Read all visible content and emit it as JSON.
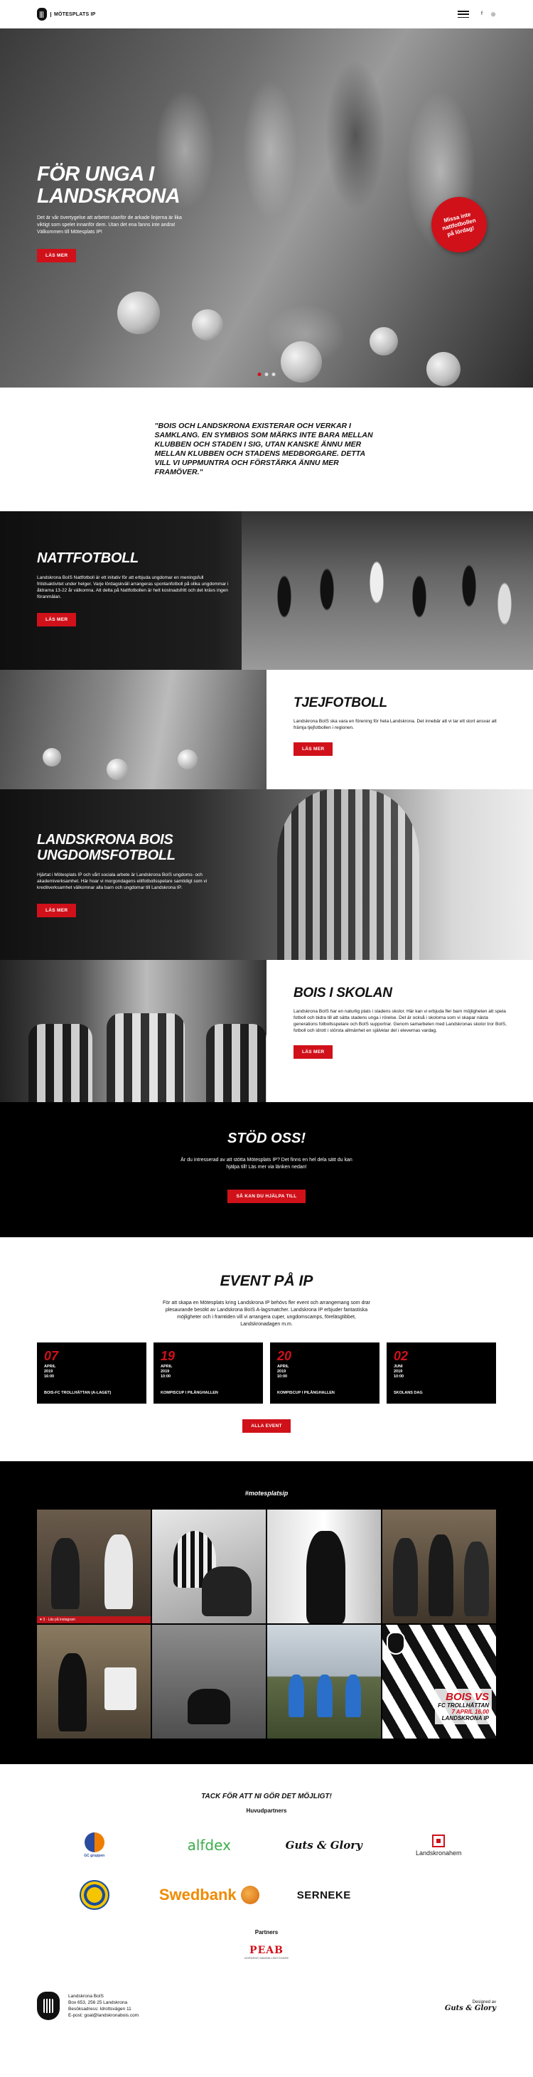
{
  "header": {
    "logo_text": "MÖTESPLATS IP",
    "social": [
      "f",
      "◎"
    ]
  },
  "hero": {
    "title": "FÖR UNGA I LANDSKRONA",
    "text": "Det är vår övertygelse att arbetet utanför de arkade linjerna är lika viktigt som spelet innanför dem. Utan det ena fanns inte andra! Välkommen till Mötesplats IP!",
    "button": "LÄS MER",
    "stamp": "Missa inte nattfotbollen på lördag!"
  },
  "quote": "\"BOIS OCH LANDSKRONA EXISTERAR OCH VERKAR I SAMKLANG. EN SYMBIOS SOM MÄRKS INTE BARA MELLAN KLUBBEN OCH STADEN I SIG, UTAN KANSKE ÄNNU MER MELLAN KLUBBEN OCH STADENS MEDBORGARE. DETTA VILL VI UPPMUNTRA OCH FÖRSTÄRKA ÄNNU MER FRAMÖVER.\"",
  "nattfotboll": {
    "title": "NATTFOTBOLL",
    "text": "Landskrona BoIS Nattfotboll är ett initativ för att erbjuda ungdomar en meningsfull fritidsaktivitet under helger. Varje lördagskväll arrangeras spontanfotboll på olika ungdommar i åldrarna 13-22 år välkomna. Att delta på Nattfotbollen är helt kostnadsfritt och det krävs ingen föranmälan.",
    "button": "LÄS MER"
  },
  "tjejfotboll": {
    "title": "TJEJFOTBOLL",
    "text": "Landskrona BoIS ska vara en förening för hela Landskrona. Det innebär att vi tar ett stort ansvar att främja tjejfotbollen i regionen.",
    "button": "LÄS MER"
  },
  "ungdomsfotboll": {
    "title": "LANDSKRONA BOIS UNGDOMSFOTBOLL",
    "text": "Hjärtat i Mötesplats IP och vårt sociala arbete är Landskrona BoIS ungdoms- och akademiverksamhet. Här hoar vi morgondagens elitfotbollsspelare samtidigt som vi kreditverksamhet välkomnar alla barn och ungdomar till Landskrona IP.",
    "button": "LÄS MER"
  },
  "skolan": {
    "title": "BOIS I SKOLAN",
    "text": "Landskrona BoIS har en naturlig plats i stadens skolor. Här kan vi erbjuda fler barn möjligheten att spela fotboll och bidra till att sätta stadens unga i rörelse. Det är också i skolorna som vi skapar nästa generations fotbollsspelare och BoIS supportrar. Genom samarbeten med Landskronas skolor tror BoIS, fotboll och idrott i största allmänhet en självklar del i elevernas vardag.",
    "button": "LÄS MER"
  },
  "support": {
    "title": "STÖD OSS!",
    "text": "Är du intresserad av att stötta Mötesplats IP? Det finns en hel dela sätt du kan hjälpa till! Läs mer via länken nedan!",
    "button": "SÅ KAN DU HJÄLPA TILL"
  },
  "events": {
    "title": "EVENT PÅ IP",
    "text": "För att skapa en Mötesplats kring Landskrona IP behövs fler event och arrangemang som drar plesaurande besökt av Landskrona BoIS A-lagsmatcher. Landskrona IP erbjuder fantastiska möjligheter och i framtiden vill vi arrangera cuper, ungdomscamps, föreläsgtibbet, Landskronadagen m.m.",
    "items": [
      {
        "day": "07",
        "month": "APRIL",
        "year": "2019",
        "time": "16:00",
        "title": "BOIS-FC TROLLHÄTTAN (A-LAGET)"
      },
      {
        "day": "19",
        "month": "APRIL",
        "year": "2019",
        "time": "10:00",
        "title": "KOMPISCUP I PILÅNGHALLEN"
      },
      {
        "day": "20",
        "month": "APRIL",
        "year": "2019",
        "time": "10:00",
        "title": "KOMPISCUP I PILÅNGHALLEN"
      },
      {
        "day": "02",
        "month": "JUNI",
        "year": "2019",
        "time": "10:00",
        "title": "SKOLANS DAG"
      }
    ],
    "button": "ALLA EVENT"
  },
  "instagram": {
    "tag": "#motesplatsip",
    "caption": "♥ 3 · Läs på instagram",
    "promo": {
      "line1": "BOIS",
      "vs": "VS",
      "line2": "FC TROLLHÄTTAN",
      "line3": "7 APRIL 16.00",
      "line4": "LANDSKRONA IP"
    }
  },
  "partners": {
    "thanks": "TACK FÖR ATT NI GÖR DET MÖJLIGT!",
    "main_label": "Huvudpartners",
    "main": [
      "GC gruppen",
      "alfdex",
      "Guts & Glory",
      "Landskronahem",
      "",
      "Swedbank",
      "SERNEKE"
    ],
    "label": "Partners",
    "peab": "PEAB",
    "peab_sub": "NORDENS SAMHÄLLSBYGGARE"
  },
  "footer": {
    "name": "Landskrona BoIS",
    "address": "Box 653, 256 25 Landskrona",
    "visit": "Besöksadress: Idrottsvägen 11",
    "email": "E-post: goal@landskronabois.com",
    "designed_by": "Designed av",
    "designer": "Guts & Glory"
  }
}
